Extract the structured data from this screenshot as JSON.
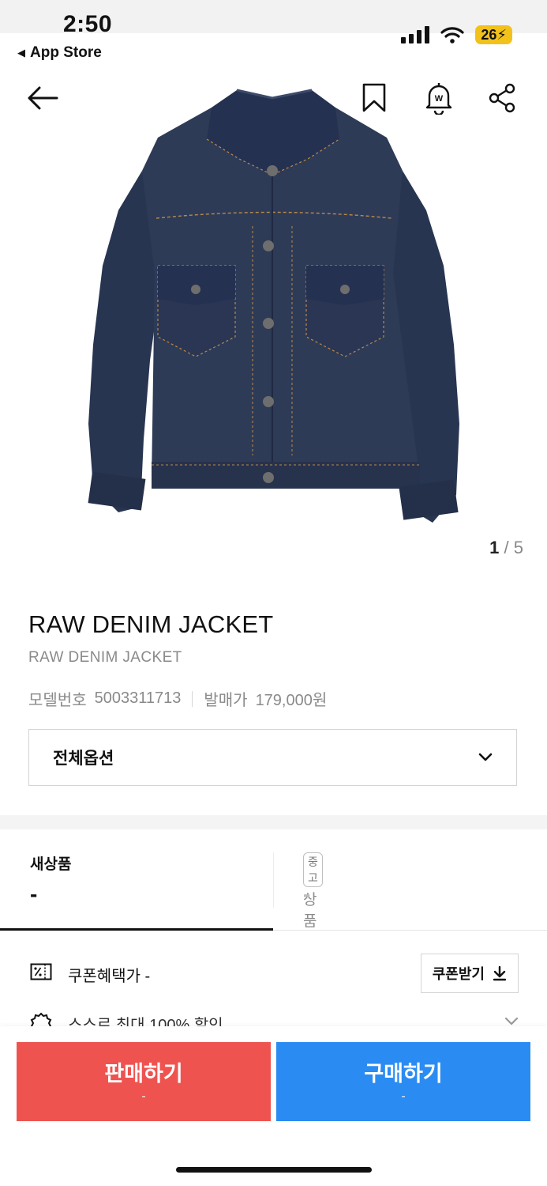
{
  "status_bar": {
    "time": "2:50",
    "back_app": "App Store",
    "battery": "26"
  },
  "gallery": {
    "current": "1",
    "total": "5"
  },
  "product": {
    "name": "RAW DENIM JACKET",
    "subtitle": "RAW DENIM JACKET",
    "model_label": "모델번호",
    "model_number": "5003311713",
    "release_label": "발매가",
    "release_price": "179,000원"
  },
  "options": {
    "label": "전체옵션"
  },
  "tabs": [
    {
      "label": "새상품",
      "value": "-"
    },
    {
      "badge": "중고",
      "label": "상품",
      "value": "-"
    }
  ],
  "coupon": {
    "label": "쿠폰혜택가 -",
    "button": "쿠폰받기"
  },
  "points": {
    "label": "스스로 최대 100% 할인"
  },
  "actions": {
    "sell": {
      "label": "판매하기",
      "price": "-"
    },
    "buy": {
      "label": "구매하기",
      "price": "-"
    }
  },
  "colors": {
    "sell": "#ef5350",
    "buy": "#2a8cf2",
    "denim": "#2b3852",
    "stitch": "#b98a4a"
  }
}
